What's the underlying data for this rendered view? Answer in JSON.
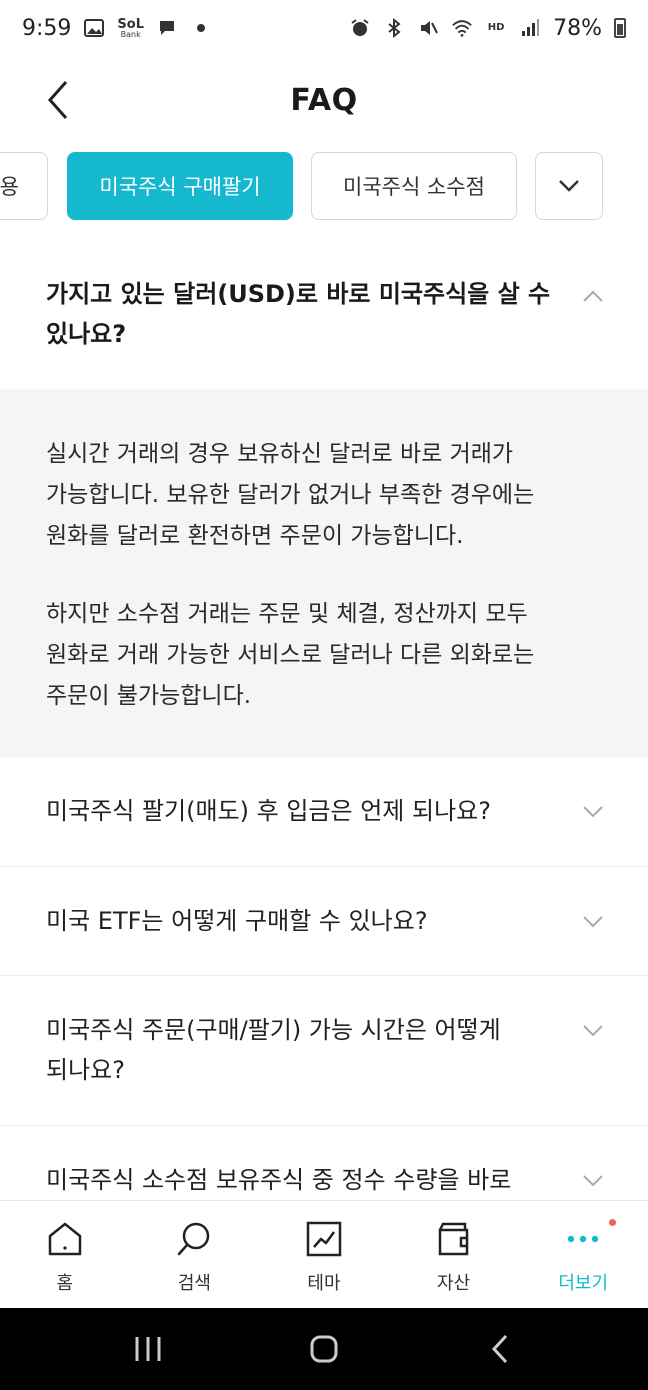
{
  "status_bar": {
    "time": "9:59",
    "battery": "78%",
    "app_logo_top": "SoL",
    "app_logo_bottom": "Bank"
  },
  "header": {
    "title": "FAQ"
  },
  "tabs": [
    {
      "label": "용"
    },
    {
      "label": "미국주식 구매팔기"
    },
    {
      "label": "미국주식 소수점"
    }
  ],
  "faq": {
    "open_question_line1": "가지고 있는 달러(USD)로 바로 미국주식을 살 수",
    "open_question_line2": "있나요?",
    "answer_p1_line1": "실시간 거래의 경우 보유하신 달러로 바로 거래가",
    "answer_p1_line2": "가능합니다. 보유한 달러가 없거나 부족한 경우에는",
    "answer_p1_line3": "원화를 달러로 환전하면 주문이 가능합니다.",
    "answer_p2_line1": "하지만 소수점 거래는 주문 및 체결, 정산까지 모두",
    "answer_p2_line2": "원화로 거래 가능한 서비스로 달러나 다른 외화로는",
    "answer_p2_line3": "주문이 불가능합니다.",
    "items": [
      {
        "line1": "미국주식 팔기(매도) 후 입금은 언제 되나요?",
        "line2": ""
      },
      {
        "line1": "미국 ETF는 어떻게 구매할 수 있나요?",
        "line2": ""
      },
      {
        "line1": "미국주식 주문(구매/팔기) 가능 시간은 어떻게",
        "line2": "되나요?"
      },
      {
        "line1": "미국주식 소수점 보유주식 중 정수 수량을 바로",
        "line2": ""
      }
    ]
  },
  "bottom_nav": [
    {
      "label": "홈"
    },
    {
      "label": "검색"
    },
    {
      "label": "테마"
    },
    {
      "label": "자산"
    },
    {
      "label": "더보기"
    }
  ],
  "colors": {
    "accent": "#16b8cf",
    "answer_bg": "#f5f5f5",
    "notification_dot": "#f0605a"
  }
}
